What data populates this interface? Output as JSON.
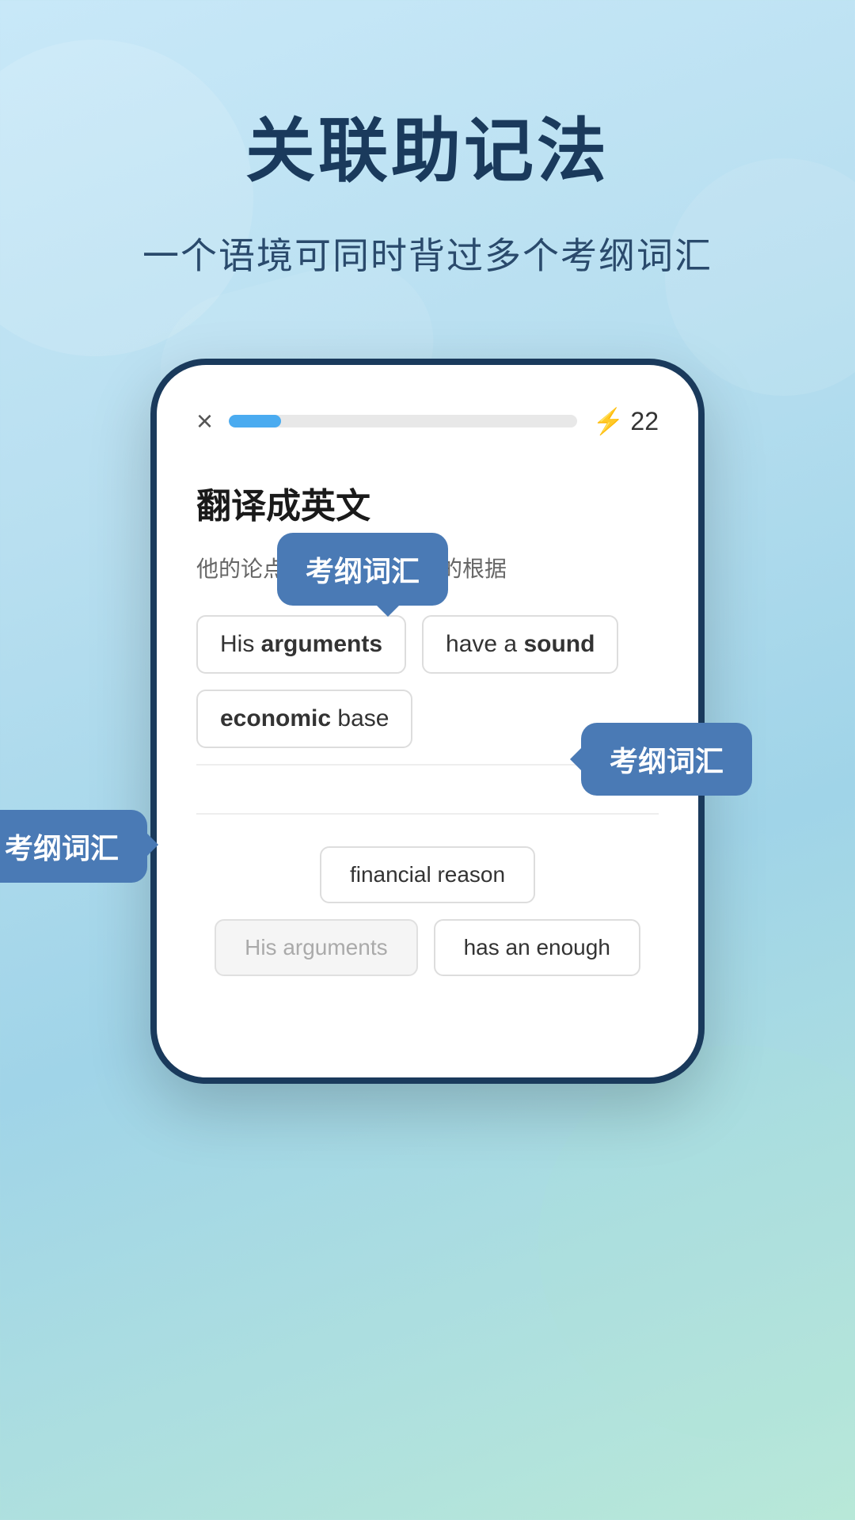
{
  "page": {
    "background": "light-blue-gradient"
  },
  "header": {
    "title": "关联助记法",
    "subtitle": "一个语境可同时背过多个考纲词汇"
  },
  "phone": {
    "top_bar": {
      "close_label": "×",
      "progress_percent": 15,
      "score_label": "22",
      "lightning_icon": "⚡"
    },
    "card": {
      "title": "翻译成英文",
      "subtitle": "他的论点有充分的经济上的根据",
      "answer_options": [
        {
          "id": 1,
          "parts": [
            {
              "text": "His ",
              "bold": false
            },
            {
              "text": "arguments",
              "bold": true
            }
          ]
        },
        {
          "id": 2,
          "parts": [
            {
              "text": "have a ",
              "bold": false
            },
            {
              "text": "sound",
              "bold": true
            }
          ]
        },
        {
          "id": 3,
          "parts": [
            {
              "text": "economic",
              "bold": true
            },
            {
              "text": " base",
              "bold": false
            }
          ]
        }
      ],
      "bottom_options": [
        {
          "id": 4,
          "text": "financial reason",
          "disabled": false
        },
        {
          "id": 5,
          "text": "His arguments",
          "disabled": true
        },
        {
          "id": 6,
          "text": "has an enough",
          "disabled": false
        }
      ]
    },
    "tooltips": [
      {
        "id": 1,
        "text": "考纲词汇",
        "position": "top"
      },
      {
        "id": 2,
        "text": "考纲词汇",
        "position": "right"
      },
      {
        "id": 3,
        "text": "考纲词汇",
        "position": "left"
      }
    ]
  }
}
